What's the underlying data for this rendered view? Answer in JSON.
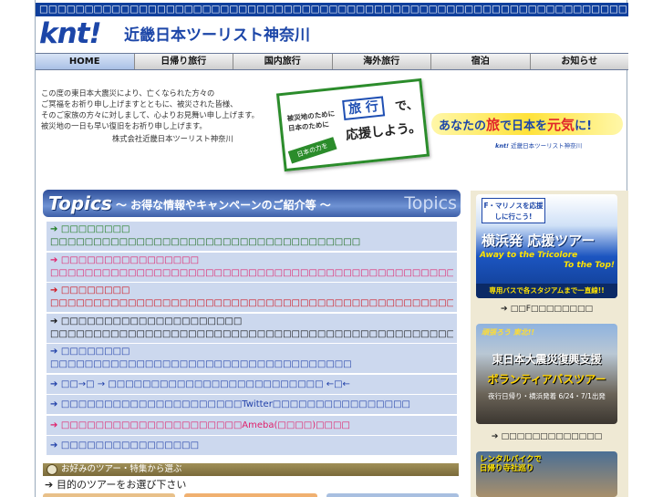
{
  "top_banner": "□□□□□□□□□□□□□□□□□□□□□□□□□□□□□□□□□□□□□□□□□□□□□□□□□□□□□□□□□□□□□□□□□",
  "header": {
    "logo": "knt!",
    "brand": "近畿日本ツーリスト神奈川"
  },
  "nav": {
    "items": [
      {
        "label": "HOME",
        "active": true
      },
      {
        "label": "日帰り旅行",
        "active": false
      },
      {
        "label": "国内旅行",
        "active": false
      },
      {
        "label": "海外旅行",
        "active": false
      },
      {
        "label": "宿泊",
        "active": false
      },
      {
        "label": "お知らせ",
        "active": false
      }
    ]
  },
  "notice": {
    "lines": [
      "この度の東日本大震災により、亡くなられた方々の",
      "ご冥福をお祈り申し上げますとともに、被災された皆様、",
      "そのご家族の方々に対しまして、心よりお見舞い申し上げます。",
      "被災地の一日も早い復旧をお祈り申し上げます。"
    ],
    "signature": "株式会社近畿日本ツーリスト神奈川"
  },
  "campaign_card": {
    "line1": "被災地のために",
    "line2": "日本のために",
    "travel": "旅 行",
    "de": "で、",
    "lets": "応援しよう。",
    "flag": "日本の力を"
  },
  "genki": {
    "pre": "あなたの",
    "tabi": "旅",
    "mid": "で日本を",
    "genki": "元気",
    "post": "に!",
    "sub_logo": "knt!",
    "sub_text": "近畿日本ツーリスト神奈川"
  },
  "topics_header": {
    "logo": "Topics",
    "subtitle": "～ お得な情報やキャンペーンのご紹介等 ～",
    "right": "Topics"
  },
  "topics": [
    {
      "title": "□□□□□□□□",
      "title_color": "#1a7a1a",
      "desc": "□□□□□□□□□□□□□□□□□□□□□□□□□□□□□□□□□□□□",
      "desc_color": "#1a6a1a"
    },
    {
      "title": "□□□□□□□□□□□□□□□□",
      "title_color": "#e0206a",
      "desc": "□□□□□□□□□□□□□□□□□□□□□□□□□□□□□□□□□□□□□□□□□□□□□□□□□□",
      "desc_color": "#e0206a"
    },
    {
      "title": "□□□□□□□□",
      "title_color": "#d0101a",
      "desc": "□□□□□□□□□□□□□□□□□□□□□□□□□□□□□□□□□□□□□□□□□□□□□□□□□□",
      "desc_color": "#d0101a"
    },
    {
      "title": "□□□□□□□□□□□□□□□□□□□□□",
      "title_color": "#111111",
      "desc": "□□□□□□□□□□□□□□□□□□□□□□□□□□□□□□□□□□□□□□□□□□□□□□□□□□□",
      "desc_color": "#111111"
    },
    {
      "title": "□□□□□□□□",
      "title_color": "#1f3fa8",
      "desc": "□□□□□□□□□□□□□□□□□□□□□□□□□□□□□□□□□□□",
      "desc_color": "#1f3fa8"
    },
    {
      "title": "□□→□ → □□□□□□□□□□□□□□□□□□□□□□□□□ ←□←",
      "title_color": "#1f3fa8",
      "desc": "",
      "desc_color": ""
    },
    {
      "title": "□□□□□□□□□□□□□□□□□□□□□Twitter□□□□□□□□□□□□□□□□",
      "title_color": "#1f3fa8",
      "desc": "",
      "desc_color": ""
    },
    {
      "title": "□□□□□□□□□□□□□□□□□□□□□Ameba(□□□□)□□□□",
      "title_color": "#e0206a",
      "desc": "",
      "desc_color": ""
    },
    {
      "title": "□□□□□□□□□□□□□□□□",
      "title_color": "#1f3fa8",
      "desc": "",
      "desc_color": ""
    }
  ],
  "choose_bar": "お好みのツアー・特集から選ぶ",
  "choose_line": "目的のツアーをお選び下さい",
  "choose_tabs": [
    "#e8c089",
    "#f0b070",
    "#a8bfe0"
  ],
  "sidebar": {
    "banner1": {
      "cap": "F・マリノスを応援しに行こう!",
      "title": "横浜発 応援ツアー",
      "en1": "Away to the Tricolore",
      "en2": "To the Top!",
      "bottom": "専用バスで各スタジアムまで一直線!!"
    },
    "link1": "□□F□□□□□□□□",
    "banner2": {
      "cap": "頑張ろう 東北!!",
      "title": "東日本大震災復興支援",
      "sub": "ボランティアバスツアー",
      "note": "夜行日帰り・横浜発着 6/24・7/1出発"
    },
    "link2": "□□□□□□□□□□□□□",
    "banner3": {
      "cap1": "レンタルバイクで",
      "cap2": "日帰り寺社巡り"
    }
  }
}
